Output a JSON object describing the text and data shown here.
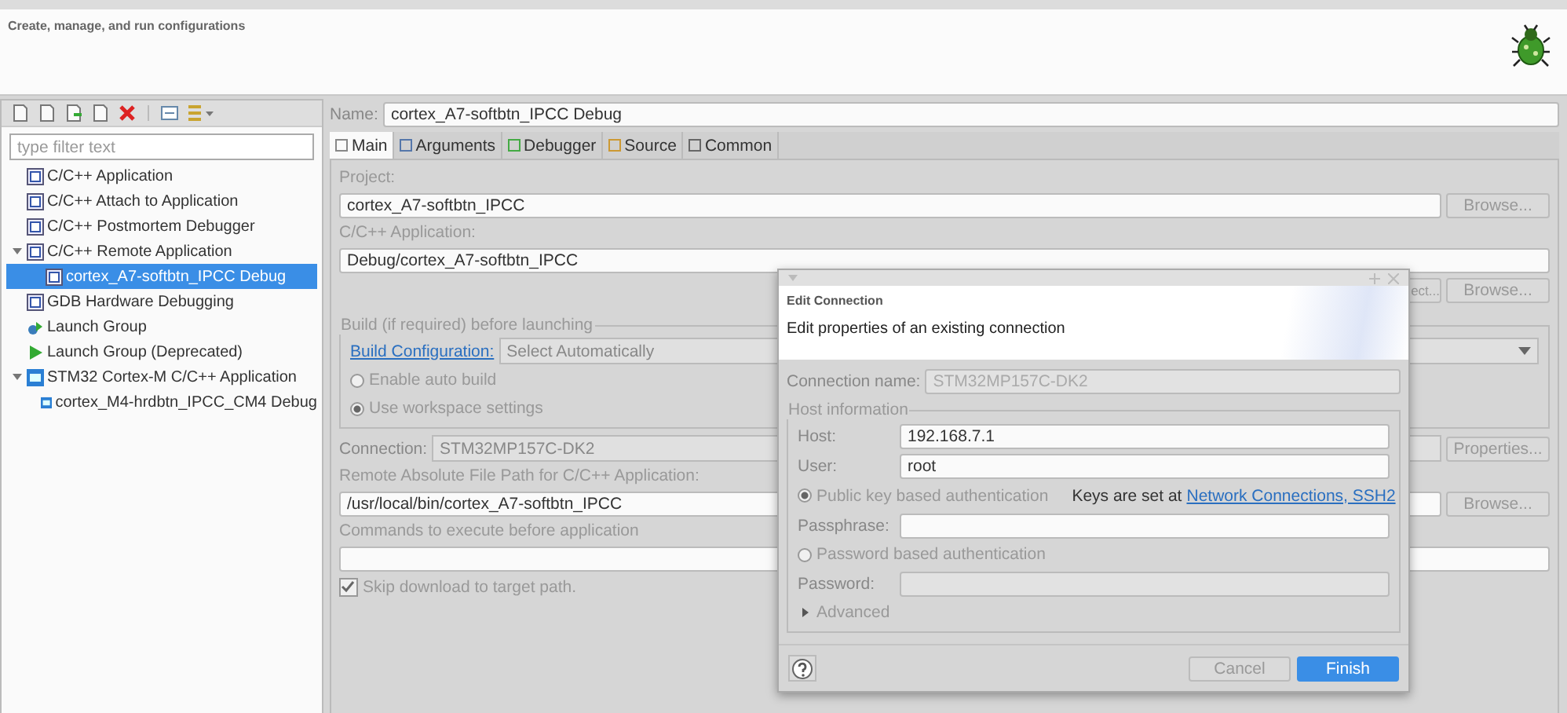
{
  "header": {
    "description": "Create, manage, and run configurations"
  },
  "sidebar": {
    "filter": {
      "placeholder": "type filter text"
    },
    "tree": [
      {
        "label": "C/C++ Application",
        "kind": "c",
        "selected": false
      },
      {
        "label": "C/C++ Attach to Application",
        "kind": "c",
        "selected": false
      },
      {
        "label": "C/C++ Postmortem Debugger",
        "kind": "c",
        "selected": false
      },
      {
        "label": "C/C++ Remote Application",
        "kind": "c",
        "selected": false,
        "expanded": true,
        "children": [
          {
            "label": "cortex_A7-softbtn_IPCC Debug",
            "kind": "c",
            "selected": true
          }
        ]
      },
      {
        "label": "GDB Hardware Debugging",
        "kind": "c",
        "selected": false
      },
      {
        "label": "Launch Group",
        "kind": "group",
        "selected": false
      },
      {
        "label": "Launch Group (Deprecated)",
        "kind": "play",
        "selected": false
      },
      {
        "label": "STM32 Cortex-M C/C++ Application",
        "kind": "ide",
        "selected": false,
        "expanded": true,
        "children": [
          {
            "label": "cortex_M4-hrdbtn_IPCC_CM4 Debug",
            "kind": "ide",
            "selected": false
          }
        ]
      }
    ]
  },
  "config": {
    "name_label": "Name:",
    "name": "cortex_A7-softbtn_IPCC Debug",
    "tabs": [
      {
        "label": "Main",
        "selected": true
      },
      {
        "label": "Arguments",
        "selected": false
      },
      {
        "label": "Debugger",
        "selected": false
      },
      {
        "label": "Source",
        "selected": false
      },
      {
        "label": "Common",
        "selected": false
      }
    ],
    "project_label": "Project:",
    "project": "cortex_A7-softbtn_IPCC",
    "project_button": "Browse...",
    "app_label": "C/C++ Application:",
    "app": "Debug/cortex_A7-softbtn_IPCC",
    "app_buttons": [
      "ect...",
      "Browse..."
    ],
    "build": {
      "legend": "Build (if required) before launching",
      "link": "Build Configuration:",
      "select": "Select Automatically",
      "options": [
        {
          "label": "Enable auto build",
          "selected": false
        },
        {
          "label": "Use workspace settings",
          "selected": true
        }
      ]
    },
    "connection_label": "Connection:",
    "connection": "STM32MP157C-DK2",
    "connection_button": "Properties...",
    "path_label": "Remote Absolute File Path for C/C++ Application:",
    "path": "/usr/local/bin/cortex_A7-softbtn_IPCC",
    "path_button": "Browse...",
    "commands_label": "Commands to execute before application",
    "skip": {
      "label": "Skip download to target path.",
      "checked": true
    }
  },
  "dialog": {
    "title": "Edit Connection",
    "subtitle": "Edit properties of an existing connection",
    "connection_name_label": "Connection name:",
    "connection_name": "STM32MP157C-DK2",
    "group": "Host information",
    "host_label": "Host:",
    "host": "192.168.7.1",
    "user_label": "User:",
    "user": "root",
    "auth": [
      {
        "label": "Public key based authentication",
        "selected": true
      },
      {
        "label": "Password based authentication",
        "selected": false
      }
    ],
    "keys_note": "Keys are set at",
    "keys_link": "Network Connections, SSH2",
    "passphrase_label": "Passphrase:",
    "password_label": "Password:",
    "advanced": {
      "label": "Advanced",
      "expanded": false
    },
    "buttons": [
      {
        "label": "Cancel",
        "kind": "secondary"
      },
      {
        "label": "Finish",
        "kind": "primary"
      }
    ]
  }
}
